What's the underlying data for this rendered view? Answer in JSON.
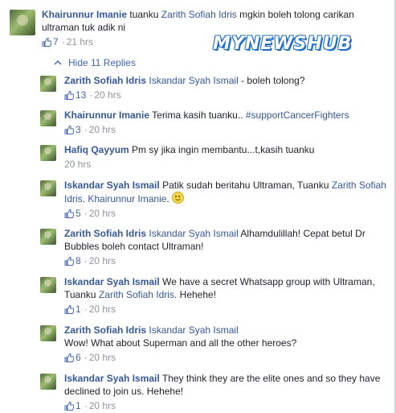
{
  "watermark": "MYNEWSHUB",
  "top_comment": {
    "author": "Khairunnur Imanie",
    "text": "tuanku",
    "tag": "Zarith Sofiah Idris",
    "text_after": "mgkin boleh tolong carikan ultraman tuk adik ni",
    "likes": "7",
    "time": "21 hrs"
  },
  "hide_replies_label": "Hide 11 Replies",
  "replies": [
    {
      "author": "Zarith Sofiah Idris",
      "tag": "Iskandar Syah Ismail",
      "text": "- boleh tolong?",
      "likes": "13",
      "time": "20 hrs"
    },
    {
      "author": "Khairunnur Imanie",
      "text": "Terima kasih tuanku..",
      "hashtag": "#supportCancerFighters",
      "likes": "3",
      "time": "20 hrs"
    },
    {
      "author": "Hafiq Qayyum",
      "text": "Pm sy jika ingin membantu...t,kasih tuanku",
      "time": "20 hrs"
    },
    {
      "author": "Iskandar Syah Ismail",
      "text": "Patik sudah beritahu Ultraman, Tuanku",
      "tag": "Zarith Sofiah Idris",
      "tag2": "Khairunnur Imanie",
      "likes": "5",
      "time": "20 hrs"
    },
    {
      "author": "Zarith Sofiah Idris",
      "tag": "Iskandar Syah Ismail",
      "text": "Alhamdulillah! Cepat betul Dr Bubbles boleh contact Ultraman!",
      "likes": "8",
      "time": "20 hrs"
    },
    {
      "author": "Iskandar Syah Ismail",
      "text": "We have a secret Whatsapp group with Ultraman, Tuanku",
      "tag": "Zarith Sofiah Idris",
      "text_after": "Hehehe!",
      "likes": "1",
      "time": "20 hrs"
    },
    {
      "author": "Zarith Sofiah Idris",
      "tag": "Iskandar Syah Ismail",
      "text": "Wow! What about Superman and all the other heroes?",
      "likes": "6",
      "time": "20 hrs"
    },
    {
      "author": "Iskandar Syah Ismail",
      "text": "They think they are the elite ones and so they have declined to join us. Hehehe!",
      "likes": "1",
      "time": "20 hrs"
    }
  ],
  "colors": {
    "link": "#365899",
    "action": "#4267b2",
    "meta": "#90949c",
    "watermark_outline": "#1f6fc5"
  },
  "icons": {
    "like": "thumbs-up-icon",
    "hide": "chevron-up-icon",
    "emoji": "smiley-icon"
  }
}
